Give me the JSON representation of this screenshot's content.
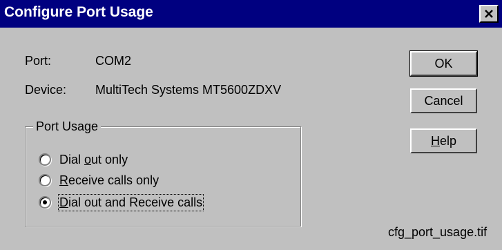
{
  "window": {
    "title": "Configure Port Usage",
    "title_bar_color": "#000080",
    "close_icon": "close-icon"
  },
  "info": {
    "port_label": "Port:",
    "port_value": "COM2",
    "device_label": "Device:",
    "device_value": "MultiTech Systems MT5600ZDXV"
  },
  "port_usage": {
    "legend": "Port Usage",
    "options": [
      {
        "pre": "Dial ",
        "accel": "o",
        "post": "ut only",
        "selected": false
      },
      {
        "pre": "",
        "accel": "R",
        "post": "eceive calls only",
        "selected": false
      },
      {
        "pre": "",
        "accel": "D",
        "post": "ial out and Receive calls",
        "selected": true
      }
    ]
  },
  "buttons": {
    "ok": "OK",
    "cancel": "Cancel",
    "help_accel": "H",
    "help_rest": "elp"
  },
  "footer": {
    "caption": "cfg_port_usage.tif"
  }
}
